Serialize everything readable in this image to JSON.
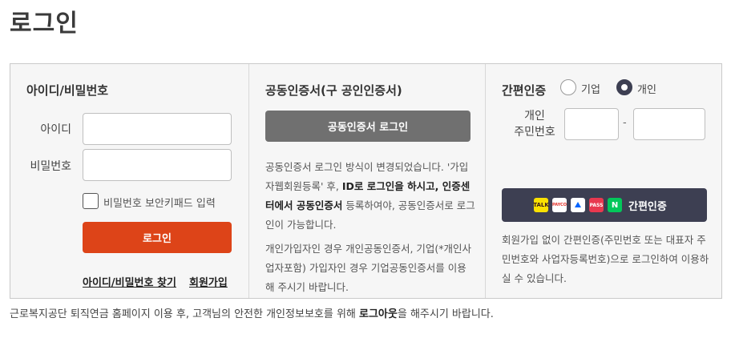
{
  "page": {
    "title": "로그인"
  },
  "id_login": {
    "title": "아이디/비밀번호",
    "id_label": "아이디",
    "id_value": "",
    "pw_label": "비밀번호",
    "pw_value": "",
    "keypad_label": "비밀번호 보안키패드 입력",
    "login_label": "로그인",
    "find_link": "아이디/비밀번호 찾기",
    "join_link": "회원가입"
  },
  "cert_login": {
    "title": "공동인증서(구 공인인증서)",
    "button_label": "공동인증서 로그인",
    "para1_a": "공동인증서 로그인 방식이 변경되었습니다. '가입자웹회원등록' 후, ",
    "para1_b": "ID로 로그인을 하시고, 인증센터에서 공동인증서",
    "para1_c": " 등록하여야, 공동인증서로 로그인이 가능합니다.",
    "para2": "개인가입자인 경우 개인공동인증서, 기업(*개인사업자포함) 가입자인 경우 기업공동인증서를 이용해 주시기 바랍니다."
  },
  "simple_auth": {
    "title": "간편인증",
    "options": [
      "기업",
      "개인"
    ],
    "selected": "개인",
    "rrn_label_1": "개인",
    "rrn_label_2": "주민번호",
    "rrn_front": "",
    "rrn_dash": "-",
    "rrn_back": "",
    "button_label": "간편인증",
    "provider_icons": [
      "kakao-icon",
      "payco-icon",
      "toss-icon",
      "pass-icon",
      "naver-icon"
    ],
    "provider_marks": [
      "TALK",
      "PAYCO",
      "",
      "PASS",
      "N"
    ],
    "desc": "회원가입 없이 간편인증(주민번호 또는 대표자 주민번호와 사업자등록번호)으로 로그인하여 이용하실 수 있습니다."
  },
  "footer": {
    "note_a": "근로복지공단 퇴직연금 홈페이지 이용 후, 고객님의 안전한 개인정보보호를 위해 ",
    "note_b": "로그아웃",
    "note_c": "을 해주시기 바랍니다."
  },
  "colors": {
    "login_button": "#dd4418",
    "cert_button": "#707070",
    "simple_button": "#3d3f52"
  }
}
